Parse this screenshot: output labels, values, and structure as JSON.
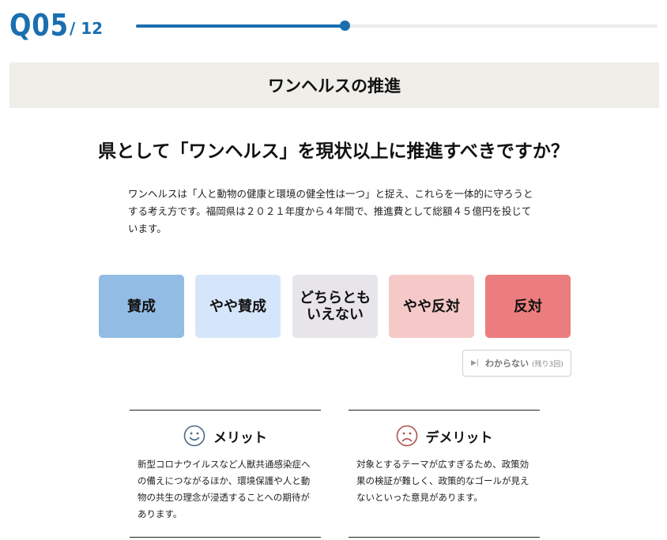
{
  "question_counter": {
    "current": "Q05",
    "total": "/ 12"
  },
  "progress": {
    "fraction": 0.4
  },
  "category": "ワンヘルスの推進",
  "question": "県として「ワンヘルス」を現状以上に推進すべきですか？",
  "explanation": "ワンヘルスは「人と動物の健康と環境の健全性は一つ」と捉え、これらを一体的に守ろうとする考え方です。福岡県は２０２１年度から４年間で、推進費として総額４５億円を投じています。",
  "choices": [
    {
      "label": "賛成",
      "color": "#92bce4"
    },
    {
      "label": "やや賛成",
      "color": "#d6e6fa"
    },
    {
      "label": "どちらとも\nいえない",
      "color": "#e7e4ea"
    },
    {
      "label": "やや反対",
      "color": "#f6c9c9"
    },
    {
      "label": "反対",
      "color": "#ec7d7e"
    }
  ],
  "skip": {
    "label": "わからない",
    "remaining": "(残り3回)"
  },
  "merit": {
    "title": "メリット",
    "text": "新型コロナウイルスなど人獣共通感染症への備えにつながるほか、環境保護や人と動物の共生の理念が浸透することへの期待があります。",
    "icon": "smile-icon",
    "icon_color": "#4a6a8a"
  },
  "demerit": {
    "title": "デメリット",
    "text": "対象とするテーマが広すぎるため、政策効果の検証が難しく、政策的なゴールが見えないといった意見があります。",
    "icon": "frown-icon",
    "icon_color": "#b0524e"
  },
  "colors": {
    "accent": "#1a6fb0",
    "banner_bg": "#efeee9"
  }
}
